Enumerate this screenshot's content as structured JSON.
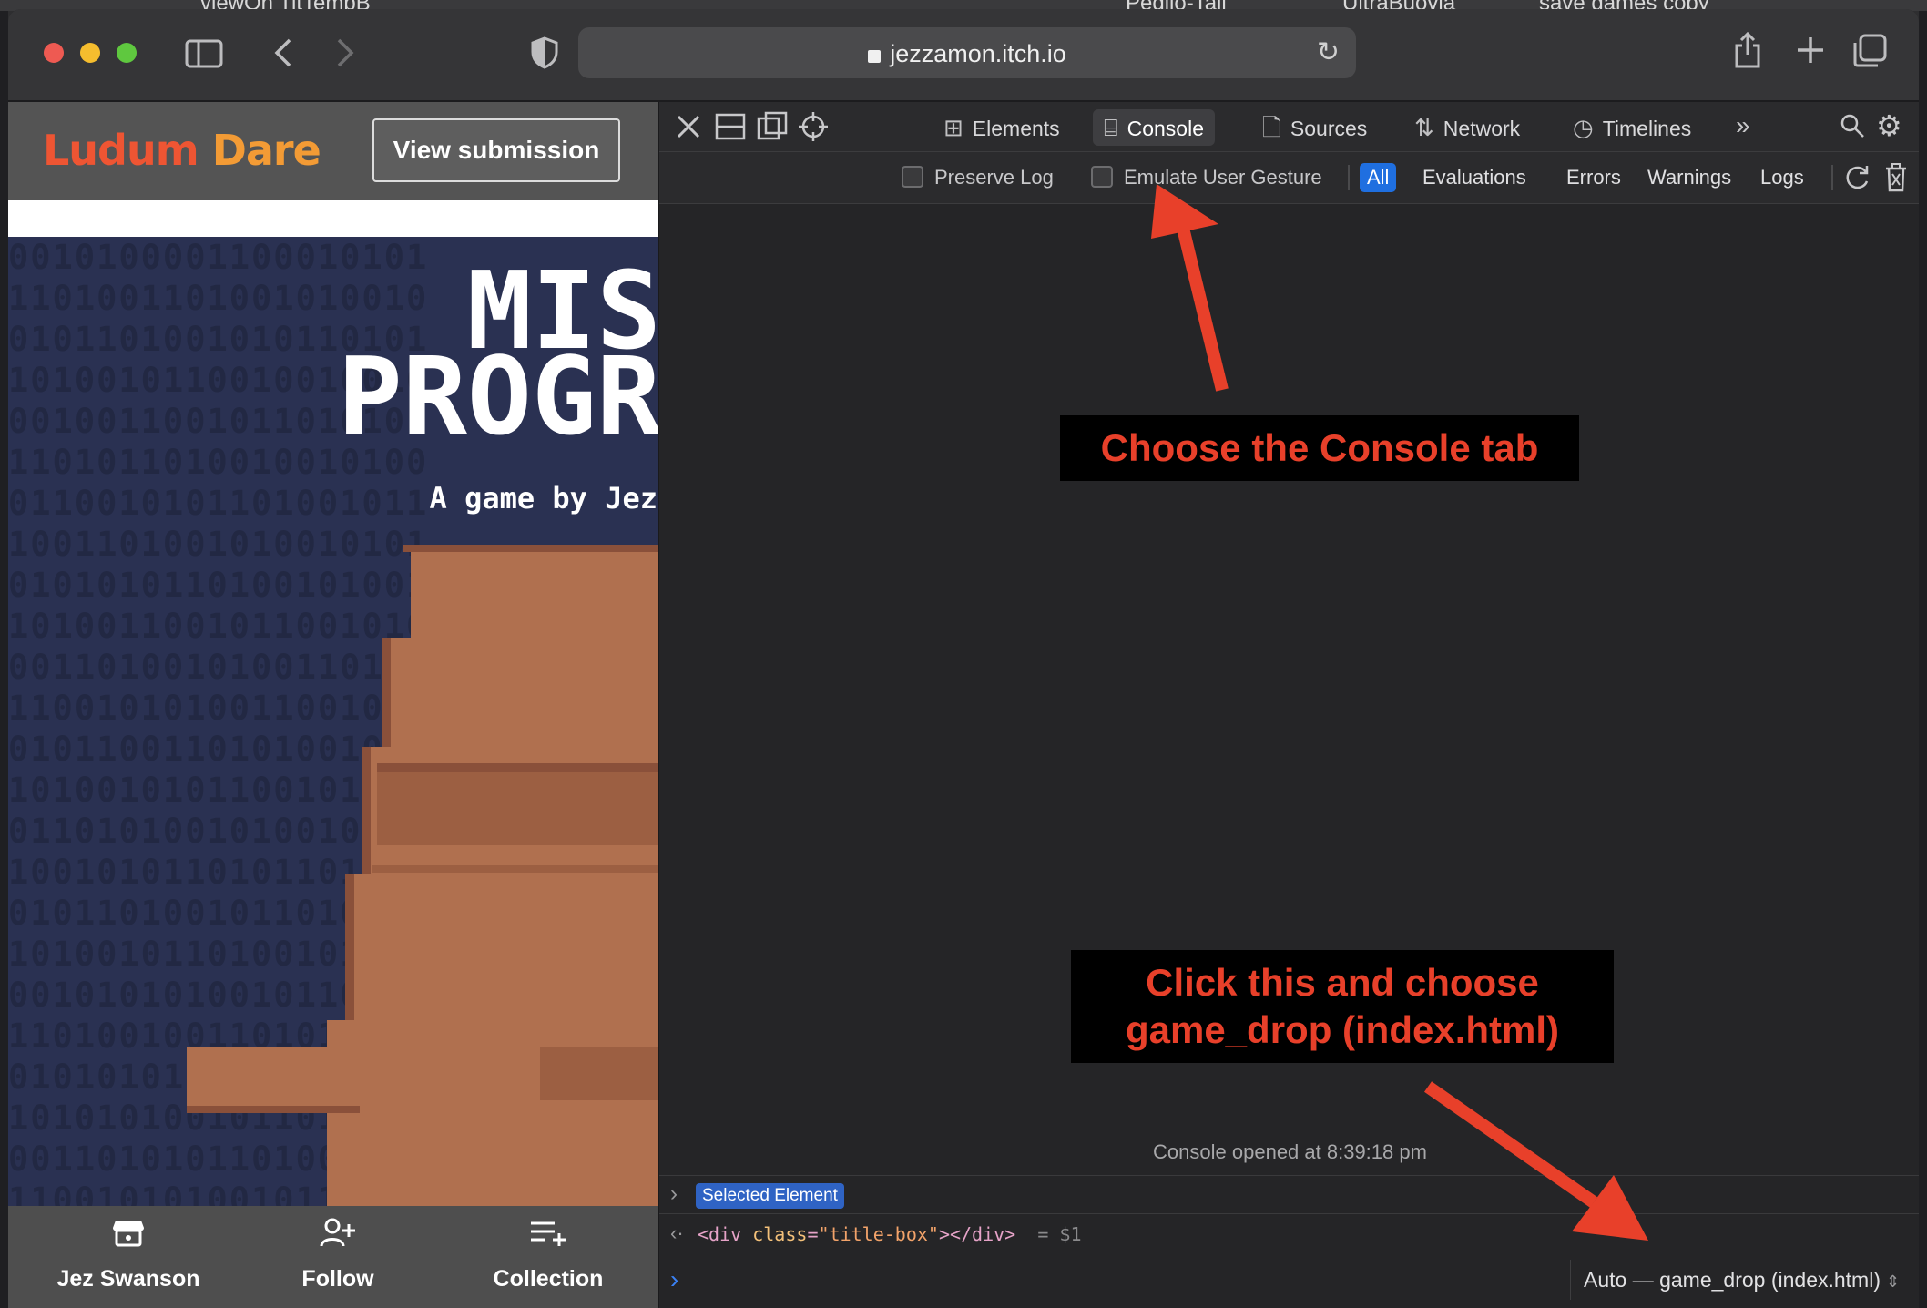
{
  "desktop": {
    "items": [
      "viewOn TitTempB",
      "Pedilo-Tall",
      "UltraBuovia",
      "save games copy"
    ]
  },
  "browser": {
    "url": "jezzamon.itch.io"
  },
  "page": {
    "logo_part1": "Ludum",
    "logo_part2": "Dare",
    "view_submission": "View submission",
    "game_title_line1": "MIS",
    "game_title_line2": "PROGR",
    "game_byline": "A game by Jez",
    "bottom_bar": [
      {
        "label": "Jez Swanson",
        "icon": "itch-store-icon"
      },
      {
        "label": "Follow",
        "icon": "follow-user-icon"
      },
      {
        "label": "Collection",
        "icon": "add-to-collection-icon"
      }
    ]
  },
  "devtools": {
    "tabs": [
      {
        "label": "Elements",
        "icon": "elements-icon"
      },
      {
        "label": "Console",
        "icon": "console-icon",
        "active": true
      },
      {
        "label": "Sources",
        "icon": "sources-icon"
      },
      {
        "label": "Network",
        "icon": "network-icon"
      },
      {
        "label": "Timelines",
        "icon": "timelines-icon"
      }
    ],
    "filters": {
      "preserve_log": "Preserve Log",
      "emulate_gesture": "Emulate User Gesture",
      "levels": [
        "All",
        "Evaluations",
        "Errors",
        "Warnings",
        "Logs"
      ],
      "active_level": "All"
    },
    "console_opened": "Console opened at 8:39:18 pm",
    "selected_element_badge": "Selected Element",
    "result_line": {
      "open_tag": "<div ",
      "attr": "class",
      "eq": "=",
      "value": "\"title-box\"",
      "close": "></div>",
      "ref": "= $1"
    },
    "execution_context": "Auto — game_drop (index.html)"
  },
  "annotations": {
    "console_tip": "Choose the Console tab",
    "context_tip_line1": "Click this and choose",
    "context_tip_line2": "game_drop (index.html)"
  },
  "colors": {
    "annotation_text": "#e8402a",
    "active_filter": "#1f6fe0",
    "page_background": "#2a3152"
  }
}
